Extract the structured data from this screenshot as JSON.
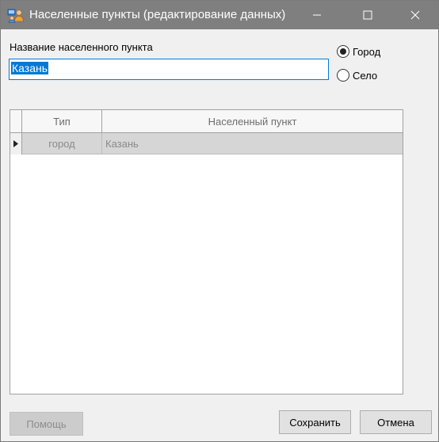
{
  "window": {
    "title": "Населенные пункты (редактирование данных)",
    "title_bar_color": "#7f7f7f"
  },
  "form": {
    "name_label": "Название населенного пункта",
    "name_value": "Казань",
    "radio_city": "Город",
    "radio_village": "Село",
    "selected_type": "Город"
  },
  "grid": {
    "columns": [
      "Тип",
      "Населенный пункт"
    ],
    "rows": [
      {
        "type": "город",
        "name": "Казань"
      }
    ]
  },
  "buttons": {
    "help": "Помощь",
    "save": "Сохранить",
    "cancel": "Отмена"
  },
  "colors": {
    "accent": "#0078d7",
    "selected_row": "#d6d6d6"
  }
}
